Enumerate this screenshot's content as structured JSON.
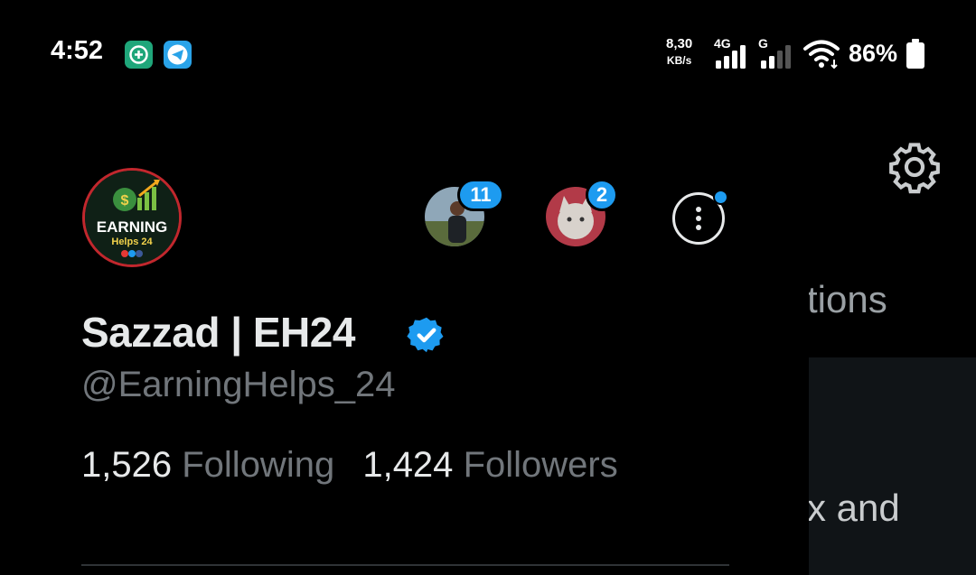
{
  "status_bar": {
    "time": "4:52",
    "notifications": [
      "message-plus-icon",
      "telegram-icon"
    ],
    "net_speed_value": "8,30",
    "net_speed_unit": "KB/s",
    "sim1_label": "4G",
    "sim2_label": "G",
    "battery_percent": "86%",
    "icons": [
      "signal-icon",
      "signal-icon",
      "wifi-icon",
      "battery-icon"
    ]
  },
  "background": {
    "text_tions": "tions",
    "text_and": "x and",
    "settings_icon": "gear-icon"
  },
  "drawer": {
    "avatar_logo_text_1": "EARNING",
    "avatar_logo_text_2": "Helps 24",
    "accounts": [
      {
        "badge": "11"
      },
      {
        "badge": "2"
      }
    ],
    "more_icon": "more-vertical-icon",
    "display_name": "Sazzad | EH24",
    "verified": true,
    "handle": "@EarningHelps_24",
    "following_count": "1,526",
    "following_label": "Following",
    "followers_count": "1,424",
    "followers_label": "Followers"
  },
  "colors": {
    "background": "#000000",
    "accent": "#1d9bf0",
    "text_primary": "#e7e9ea",
    "text_secondary": "#71767b",
    "avatar_border": "#c1272d"
  }
}
